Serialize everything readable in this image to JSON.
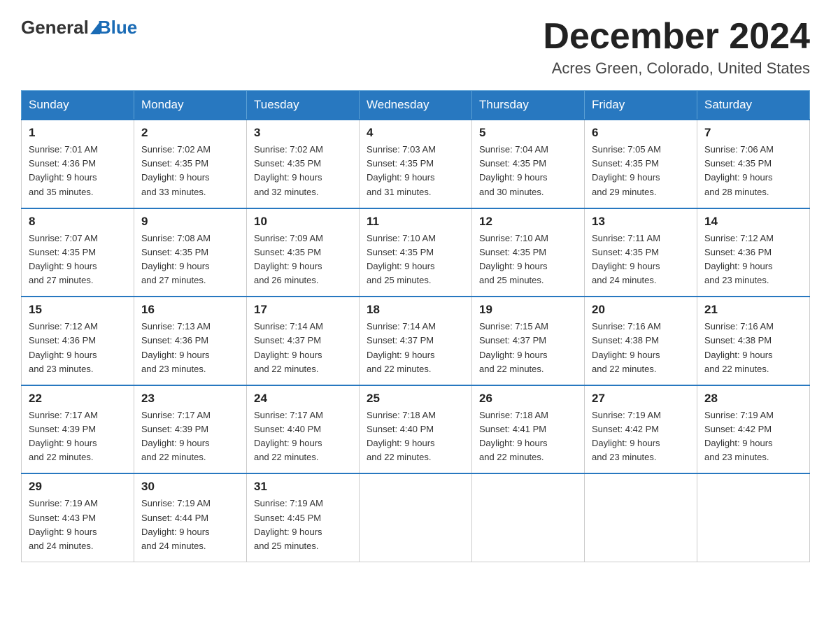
{
  "header": {
    "logo_general": "General",
    "logo_blue": "Blue",
    "title": "December 2024",
    "subtitle": "Acres Green, Colorado, United States"
  },
  "days_of_week": [
    "Sunday",
    "Monday",
    "Tuesday",
    "Wednesday",
    "Thursday",
    "Friday",
    "Saturday"
  ],
  "weeks": [
    [
      {
        "day": "1",
        "sunrise": "7:01 AM",
        "sunset": "4:36 PM",
        "daylight": "9 hours and 35 minutes."
      },
      {
        "day": "2",
        "sunrise": "7:02 AM",
        "sunset": "4:35 PM",
        "daylight": "9 hours and 33 minutes."
      },
      {
        "day": "3",
        "sunrise": "7:02 AM",
        "sunset": "4:35 PM",
        "daylight": "9 hours and 32 minutes."
      },
      {
        "day": "4",
        "sunrise": "7:03 AM",
        "sunset": "4:35 PM",
        "daylight": "9 hours and 31 minutes."
      },
      {
        "day": "5",
        "sunrise": "7:04 AM",
        "sunset": "4:35 PM",
        "daylight": "9 hours and 30 minutes."
      },
      {
        "day": "6",
        "sunrise": "7:05 AM",
        "sunset": "4:35 PM",
        "daylight": "9 hours and 29 minutes."
      },
      {
        "day": "7",
        "sunrise": "7:06 AM",
        "sunset": "4:35 PM",
        "daylight": "9 hours and 28 minutes."
      }
    ],
    [
      {
        "day": "8",
        "sunrise": "7:07 AM",
        "sunset": "4:35 PM",
        "daylight": "9 hours and 27 minutes."
      },
      {
        "day": "9",
        "sunrise": "7:08 AM",
        "sunset": "4:35 PM",
        "daylight": "9 hours and 27 minutes."
      },
      {
        "day": "10",
        "sunrise": "7:09 AM",
        "sunset": "4:35 PM",
        "daylight": "9 hours and 26 minutes."
      },
      {
        "day": "11",
        "sunrise": "7:10 AM",
        "sunset": "4:35 PM",
        "daylight": "9 hours and 25 minutes."
      },
      {
        "day": "12",
        "sunrise": "7:10 AM",
        "sunset": "4:35 PM",
        "daylight": "9 hours and 25 minutes."
      },
      {
        "day": "13",
        "sunrise": "7:11 AM",
        "sunset": "4:35 PM",
        "daylight": "9 hours and 24 minutes."
      },
      {
        "day": "14",
        "sunrise": "7:12 AM",
        "sunset": "4:36 PM",
        "daylight": "9 hours and 23 minutes."
      }
    ],
    [
      {
        "day": "15",
        "sunrise": "7:12 AM",
        "sunset": "4:36 PM",
        "daylight": "9 hours and 23 minutes."
      },
      {
        "day": "16",
        "sunrise": "7:13 AM",
        "sunset": "4:36 PM",
        "daylight": "9 hours and 23 minutes."
      },
      {
        "day": "17",
        "sunrise": "7:14 AM",
        "sunset": "4:37 PM",
        "daylight": "9 hours and 22 minutes."
      },
      {
        "day": "18",
        "sunrise": "7:14 AM",
        "sunset": "4:37 PM",
        "daylight": "9 hours and 22 minutes."
      },
      {
        "day": "19",
        "sunrise": "7:15 AM",
        "sunset": "4:37 PM",
        "daylight": "9 hours and 22 minutes."
      },
      {
        "day": "20",
        "sunrise": "7:16 AM",
        "sunset": "4:38 PM",
        "daylight": "9 hours and 22 minutes."
      },
      {
        "day": "21",
        "sunrise": "7:16 AM",
        "sunset": "4:38 PM",
        "daylight": "9 hours and 22 minutes."
      }
    ],
    [
      {
        "day": "22",
        "sunrise": "7:17 AM",
        "sunset": "4:39 PM",
        "daylight": "9 hours and 22 minutes."
      },
      {
        "day": "23",
        "sunrise": "7:17 AM",
        "sunset": "4:39 PM",
        "daylight": "9 hours and 22 minutes."
      },
      {
        "day": "24",
        "sunrise": "7:17 AM",
        "sunset": "4:40 PM",
        "daylight": "9 hours and 22 minutes."
      },
      {
        "day": "25",
        "sunrise": "7:18 AM",
        "sunset": "4:40 PM",
        "daylight": "9 hours and 22 minutes."
      },
      {
        "day": "26",
        "sunrise": "7:18 AM",
        "sunset": "4:41 PM",
        "daylight": "9 hours and 22 minutes."
      },
      {
        "day": "27",
        "sunrise": "7:19 AM",
        "sunset": "4:42 PM",
        "daylight": "9 hours and 23 minutes."
      },
      {
        "day": "28",
        "sunrise": "7:19 AM",
        "sunset": "4:42 PM",
        "daylight": "9 hours and 23 minutes."
      }
    ],
    [
      {
        "day": "29",
        "sunrise": "7:19 AM",
        "sunset": "4:43 PM",
        "daylight": "9 hours and 24 minutes."
      },
      {
        "day": "30",
        "sunrise": "7:19 AM",
        "sunset": "4:44 PM",
        "daylight": "9 hours and 24 minutes."
      },
      {
        "day": "31",
        "sunrise": "7:19 AM",
        "sunset": "4:45 PM",
        "daylight": "9 hours and 25 minutes."
      },
      null,
      null,
      null,
      null
    ]
  ],
  "labels": {
    "sunrise": "Sunrise:",
    "sunset": "Sunset:",
    "daylight": "Daylight:"
  }
}
